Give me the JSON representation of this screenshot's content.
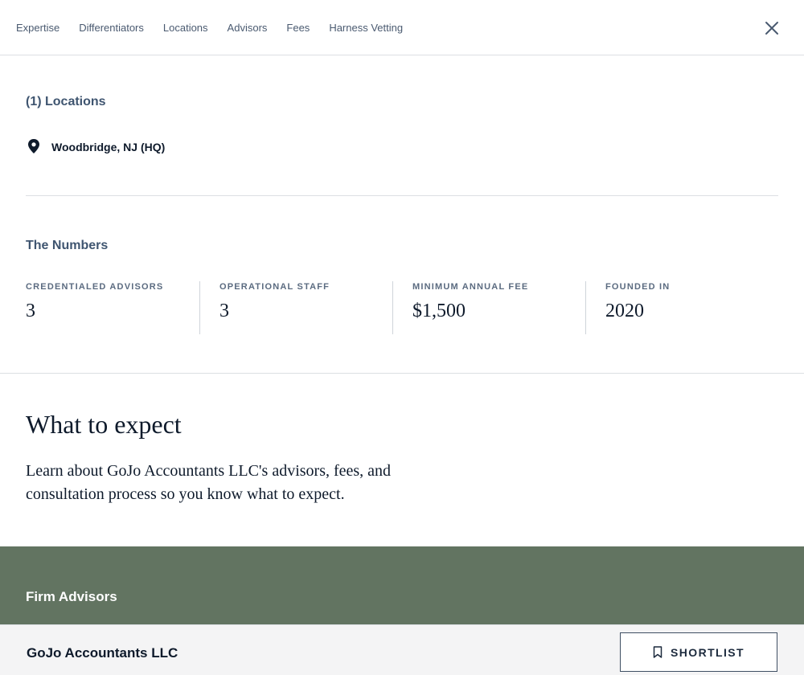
{
  "nav": {
    "tabs": [
      {
        "label": "Expertise"
      },
      {
        "label": "Differentiators"
      },
      {
        "label": "Locations"
      },
      {
        "label": "Advisors"
      },
      {
        "label": "Fees"
      },
      {
        "label": "Harness Vetting"
      }
    ],
    "close_icon": "close-icon"
  },
  "locations": {
    "title": "(1) Locations",
    "items": [
      {
        "icon": "map-pin-icon",
        "name": "Woodbridge, NJ (HQ)"
      }
    ]
  },
  "numbers": {
    "title": "The Numbers",
    "stats": [
      {
        "label": "CREDENTIALED ADVISORS",
        "value": "3"
      },
      {
        "label": "OPERATIONAL STAFF",
        "value": "3"
      },
      {
        "label": "MINIMUM ANNUAL FEE",
        "value": "$1,500"
      },
      {
        "label": "FOUNDED IN",
        "value": "2020"
      }
    ]
  },
  "expect": {
    "title": "What to expect",
    "body": "Learn about GoJo Accountants LLC's advisors, fees, and consultation process so you know what to expect."
  },
  "advisors": {
    "title": "Firm Advisors",
    "band_color": "#627461"
  },
  "footer": {
    "firm_name": "GoJo Accountants LLC",
    "shortlist_label": "SHORTLIST",
    "shortlist_icon": "bookmark-icon"
  }
}
